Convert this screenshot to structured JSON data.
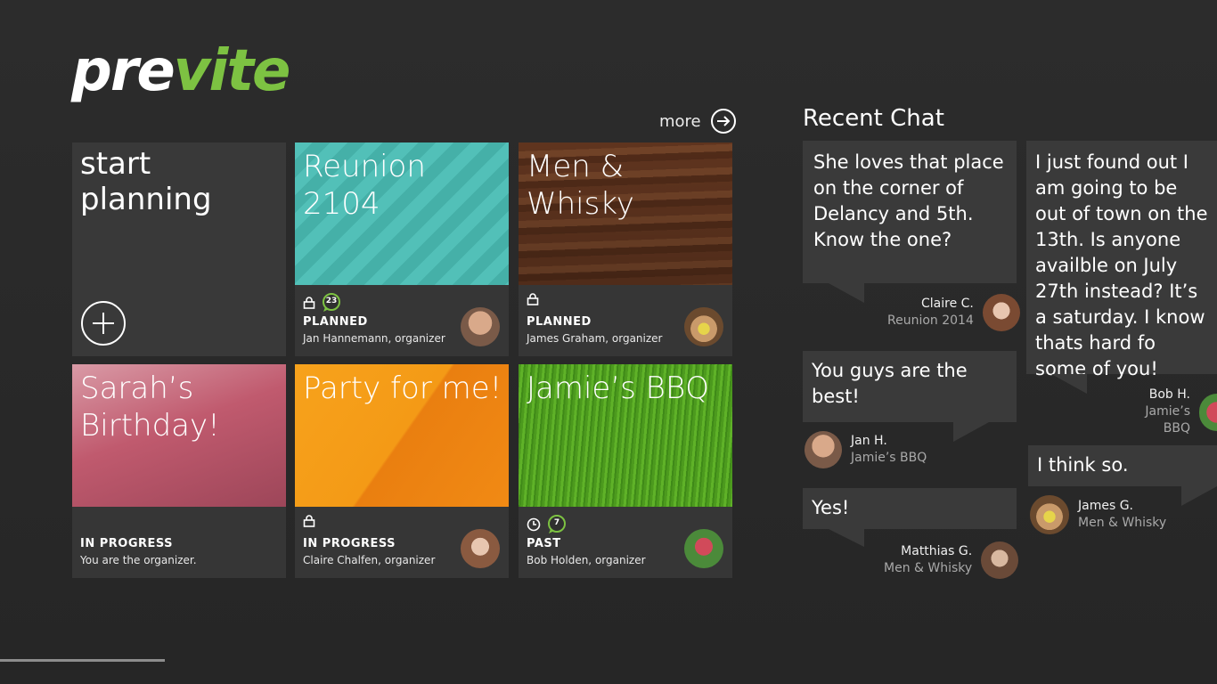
{
  "app": {
    "logo_part1": "pre",
    "logo_part2": "vite",
    "accent": "#7dc242"
  },
  "more": {
    "label": "more"
  },
  "start": {
    "line1": "start",
    "line2": "planning"
  },
  "events": [
    {
      "title": "Reunion 2104",
      "status": "PLANNED",
      "organizer": "Jan Hannemann, organizer",
      "badge": "23",
      "icons": [
        "lock-icon",
        "chat-badge-icon"
      ]
    },
    {
      "title_line1": "Men &",
      "title_line2": "Whisky",
      "status": "PLANNED",
      "organizer": "James Graham, organizer",
      "icons": [
        "lock-icon"
      ]
    },
    {
      "title_line1": "Sarah’s",
      "title_line2": "Birthday!",
      "status": "IN PROGRESS",
      "organizer": "You are the organizer."
    },
    {
      "title": "Party for me!",
      "status": "IN PROGRESS",
      "organizer": "Claire Chalfen, organizer",
      "icons": [
        "lock-icon"
      ]
    },
    {
      "title": "Jamie’s BBQ",
      "status": "PAST",
      "organizer": "Bob Holden, organizer",
      "badge": "7",
      "icons": [
        "clock-icon",
        "chat-badge-icon"
      ]
    }
  ],
  "chat": {
    "heading": "Recent Chat",
    "messages": [
      {
        "text": "She loves that place on the corner of Delancy and 5th. Know the one?",
        "name": "Claire C.",
        "event": "Reunion 2014"
      },
      {
        "text": "You guys are the best!",
        "name": "Jan H.",
        "event": "Jamie’s BBQ"
      },
      {
        "text": "Yes!",
        "name": "Matthias G.",
        "event": "Men & Whisky"
      },
      {
        "text": "I just found out I am going to be out of town on the 13th. Is anyone availble on July 27th instead? It’s a saturday. I know thats hard fo some of you!",
        "name": "Bob H.",
        "event": "Jamie’s BBQ"
      },
      {
        "text": "I think so.",
        "name": "James G.",
        "event": "Men & Whisky"
      }
    ]
  }
}
